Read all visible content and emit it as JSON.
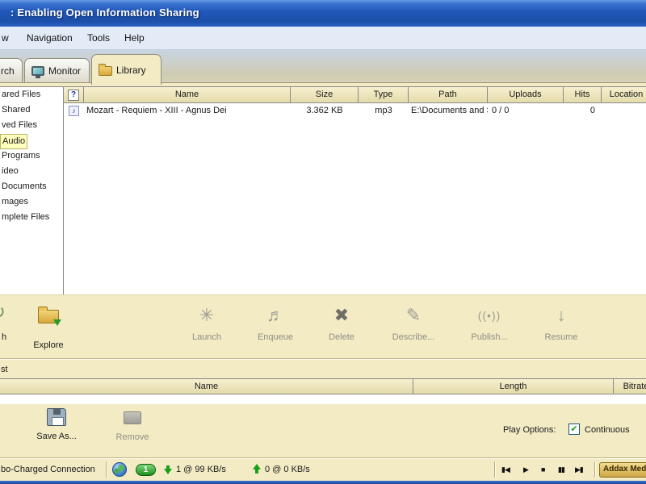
{
  "window": {
    "title": ": Enabling Open Information Sharing"
  },
  "menu": {
    "items": [
      {
        "label": "w"
      },
      {
        "label": "Navigation"
      },
      {
        "label": "Tools"
      },
      {
        "label": "Help"
      }
    ]
  },
  "tabs": {
    "items": [
      {
        "label": "rch"
      },
      {
        "label": "Monitor"
      },
      {
        "label": "Library"
      }
    ],
    "active": "Library"
  },
  "library": {
    "sidebar": {
      "items": [
        {
          "label": "ared Files",
          "selected": false
        },
        {
          "label": "Shared",
          "selected": false
        },
        {
          "label": "ved Files",
          "selected": false
        },
        {
          "label": "Audio",
          "selected": true
        },
        {
          "label": "Programs",
          "selected": false
        },
        {
          "label": "ideo",
          "selected": false
        },
        {
          "label": "Documents",
          "selected": false
        },
        {
          "label": "mages",
          "selected": false
        },
        {
          "label": "mplete Files",
          "selected": false
        }
      ]
    },
    "table": {
      "help_button": "?",
      "columns": [
        "Name",
        "Size",
        "Type",
        "Path",
        "Uploads",
        "Hits",
        "Location"
      ],
      "rows": [
        {
          "name": "Mozart - Requiem - XIII - Agnus Dei",
          "size": "3.362 KB",
          "type": "mp3",
          "path": "E:\\Documents and S...",
          "uploads": "0 / 0",
          "hits": "0",
          "location": ""
        }
      ]
    },
    "toolbar": {
      "buttons": [
        {
          "label": "h",
          "icon": "↻",
          "enabled": true
        },
        {
          "label": "Explore",
          "icon": "folder",
          "enabled": true
        },
        {
          "label": "Launch",
          "icon": "✳",
          "enabled": false
        },
        {
          "label": "Enqueue",
          "icon": "♬",
          "enabled": false
        },
        {
          "label": "Delete",
          "icon": "✖",
          "enabled": false
        },
        {
          "label": "Describe...",
          "icon": "✎",
          "enabled": false
        },
        {
          "label": "Publish...",
          "icon": "((•))",
          "enabled": false
        },
        {
          "label": "Resume",
          "icon": "↓",
          "enabled": false
        }
      ]
    }
  },
  "playlist": {
    "label": "st",
    "columns": [
      "Name",
      "Length",
      "Bitrate"
    ],
    "save_button": "Save As...",
    "remove_button": "Remove",
    "play_options_label": "Play Options:",
    "continuous_label": "Continuous",
    "continuous_checked": true,
    "checkmark": "✔"
  },
  "status_bar": {
    "connection": "bo-Charged Connection",
    "share_badge": "1",
    "download": "1 @ 99 KB/s",
    "upload": "0 @ 0 KB/s",
    "playback": [
      {
        "name": "previous",
        "glyph": "▮◀"
      },
      {
        "name": "play",
        "glyph": "▶"
      },
      {
        "name": "stop",
        "glyph": "■"
      },
      {
        "name": "pause",
        "glyph": "▮▮"
      },
      {
        "name": "next",
        "glyph": "▶▮"
      }
    ],
    "brand_button": "Addax Med"
  },
  "colors": {
    "titlebar_blue": "#1e55b4",
    "panel_tan": "#f2ebc4",
    "header_tan": "#e4dbaa",
    "selection_yellow": "#ffffbe",
    "status_green": "#18a018"
  }
}
